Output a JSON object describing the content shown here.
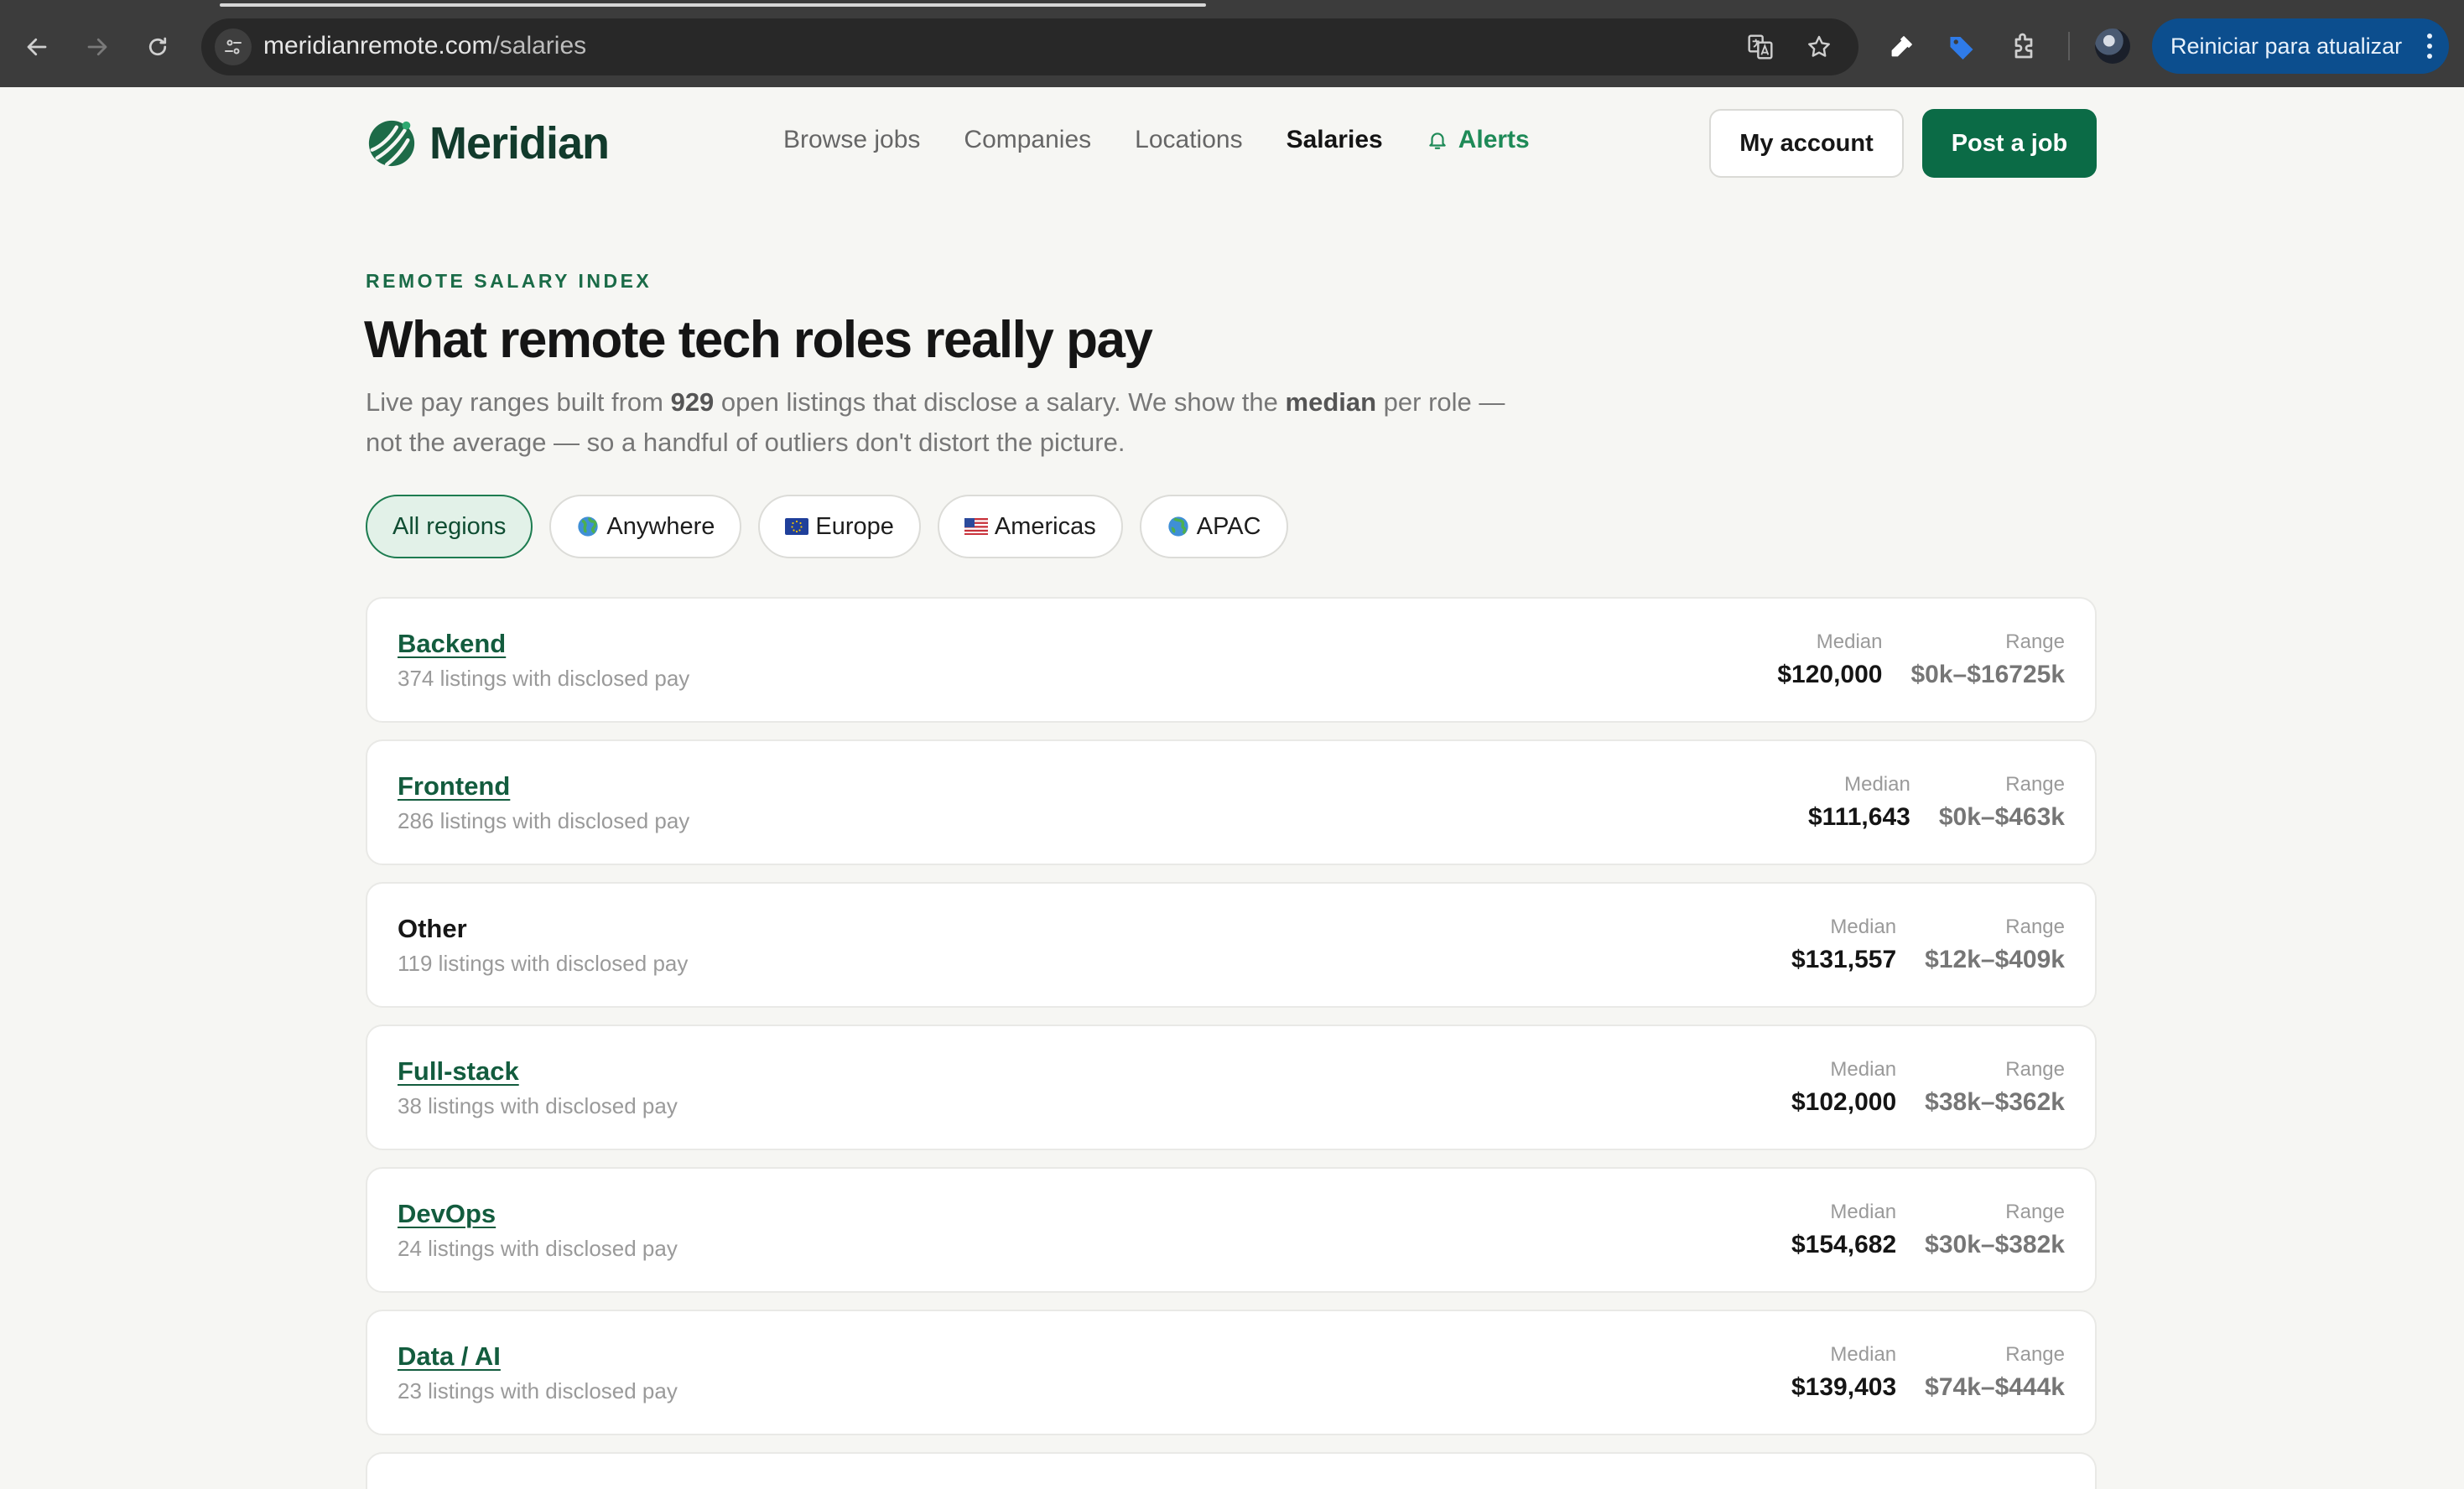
{
  "browser": {
    "url_host": "meridianremote.com",
    "url_path": "/salaries",
    "update_label": "Reiniciar para atualizar"
  },
  "site": {
    "brand": "Meridian",
    "nav": {
      "browse_jobs": "Browse jobs",
      "companies": "Companies",
      "locations": "Locations",
      "salaries": "Salaries",
      "alerts": "Alerts"
    },
    "my_account": "My account",
    "post_job": "Post a job",
    "colors": {
      "brand_green": "#0b6b46",
      "accent_green": "#1e8a57"
    }
  },
  "hero": {
    "eyebrow": "REMOTE SALARY INDEX",
    "title": "What remote tech roles really pay",
    "lead_1": "Live pay ranges built from ",
    "lead_count": "929",
    "lead_2": " open listings that disclose a salary. We show the ",
    "lead_median": "median",
    "lead_3": " per role — not the average — so a handful of outliers don't distort the picture."
  },
  "regions": [
    {
      "label": "All regions",
      "selected": true
    },
    {
      "label": "Anywhere",
      "icon": "globe-icon"
    },
    {
      "label": "Europe",
      "icon": "eu-flag-icon"
    },
    {
      "label": "Americas",
      "icon": "us-flag-icon"
    },
    {
      "label": "APAC",
      "icon": "globe-asia-icon"
    }
  ],
  "stat_labels": {
    "median": "Median",
    "range": "Range"
  },
  "roles": [
    {
      "name": "Backend",
      "count": "374 listings with disclosed pay",
      "median": "$120,000",
      "range": "$0k–$16725k",
      "linked": true
    },
    {
      "name": "Frontend",
      "count": "286 listings with disclosed pay",
      "median": "$111,643",
      "range": "$0k–$463k",
      "linked": true
    },
    {
      "name": "Other",
      "count": "119 listings with disclosed pay",
      "median": "$131,557",
      "range": "$12k–$409k",
      "linked": false
    },
    {
      "name": "Full-stack",
      "count": "38 listings with disclosed pay",
      "median": "$102,000",
      "range": "$38k–$362k",
      "linked": true
    },
    {
      "name": "DevOps",
      "count": "24 listings with disclosed pay",
      "median": "$154,682",
      "range": "$30k–$382k",
      "linked": true
    },
    {
      "name": "Data / AI",
      "count": "23 listings with disclosed pay",
      "median": "$139,403",
      "range": "$74k–$444k",
      "linked": true
    }
  ]
}
